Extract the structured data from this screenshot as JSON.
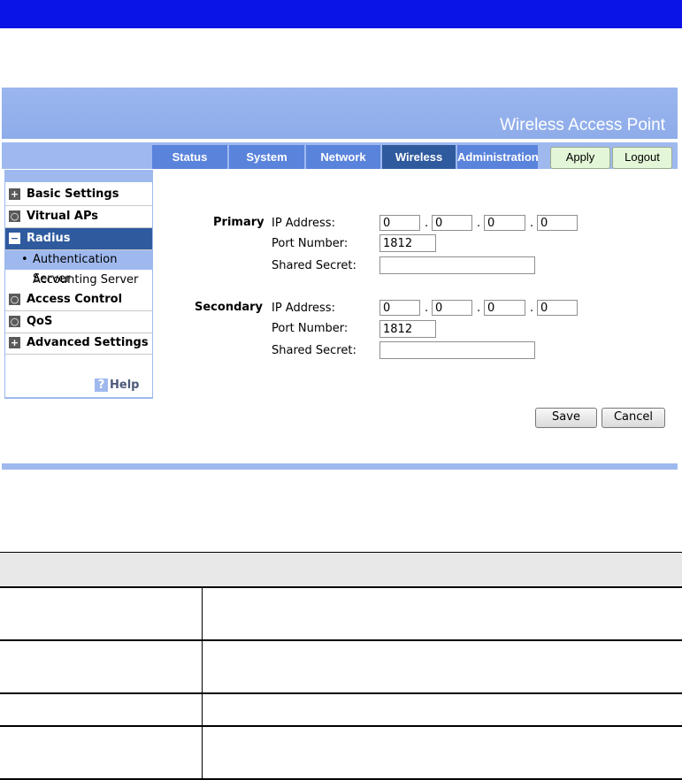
{
  "banner": {
    "title": "Wireless Access Point"
  },
  "tabs": [
    {
      "label": "Status"
    },
    {
      "label": "System"
    },
    {
      "label": "Network"
    },
    {
      "label": "Wireless"
    },
    {
      "label": "Administration"
    }
  ],
  "active_tab": "Wireless",
  "top_buttons": {
    "apply": "Apply",
    "logout": "Logout"
  },
  "sidebar": {
    "items": [
      {
        "label": "Basic Settings",
        "icon": "plus-icon"
      },
      {
        "label": "Vitrual APs",
        "icon": "circle-icon"
      },
      {
        "label": "Radius",
        "icon": "minus-icon"
      },
      {
        "label": "Authentication Server",
        "bullet": "•"
      },
      {
        "label": "Accounting Server"
      },
      {
        "label": "Access Control",
        "icon": "circle-icon"
      },
      {
        "label": "QoS",
        "icon": "circle-icon"
      },
      {
        "label": "Advanced Settings",
        "icon": "plus-icon"
      }
    ],
    "help": "Help"
  },
  "form": {
    "primary": {
      "label": "Primary",
      "ip_label": "IP Address:",
      "ip": [
        "0",
        "0",
        "0",
        "0"
      ],
      "port_label": "Port Number:",
      "port": "1812",
      "secret_label": "Shared Secret:",
      "secret": ""
    },
    "secondary": {
      "label": "Secondary",
      "ip_label": "IP Address:",
      "ip": [
        "0",
        "0",
        "0",
        "0"
      ],
      "port_label": "Port Number:",
      "port": "1812",
      "secret_label": "Shared Secret:",
      "secret": ""
    },
    "ip_separator": ".",
    "save": "Save",
    "cancel": "Cancel"
  },
  "colors": {
    "top_bar": "#0a14e6",
    "banner": "#9bb6ee",
    "tab": "#5a83dc",
    "tab_active": "#2f5a9e",
    "button_green": "#e4f6d8"
  }
}
